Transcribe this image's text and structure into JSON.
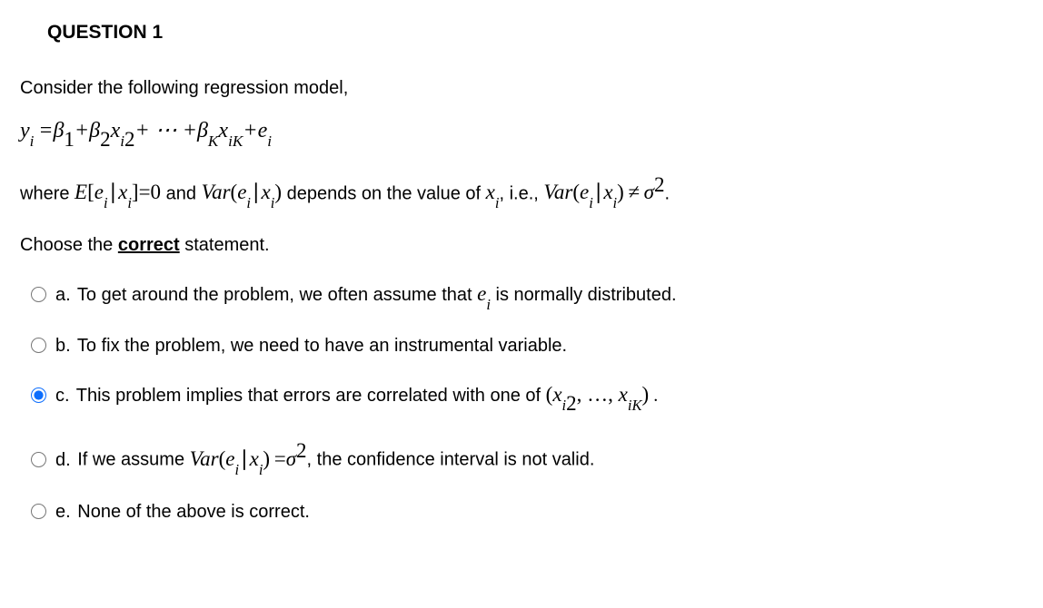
{
  "title": "QUESTION 1",
  "intro": "Consider the following regression model,",
  "choose_prefix": "Choose the ",
  "choose_bold": "correct",
  "choose_suffix": " statement.",
  "options": {
    "a": {
      "letter": "a.",
      "text": "To get around the problem, we often assume that ",
      "tail": " is normally distributed."
    },
    "b": {
      "letter": "b.",
      "text": "To fix the problem, we need to have an instrumental variable."
    },
    "c": {
      "letter": "c.",
      "text": "This problem implies that errors are correlated with one of "
    },
    "d": {
      "letter": "d.",
      "prefix": "If we assume ",
      "suffix": ", the confidence interval is not valid."
    },
    "e": {
      "letter": "e.",
      "text": "None of the above is correct."
    }
  },
  "where": {
    "w1": "where ",
    "w2": " and ",
    "w3": " depends on the value of ",
    "w4": ", i.e., "
  },
  "selected": "c"
}
